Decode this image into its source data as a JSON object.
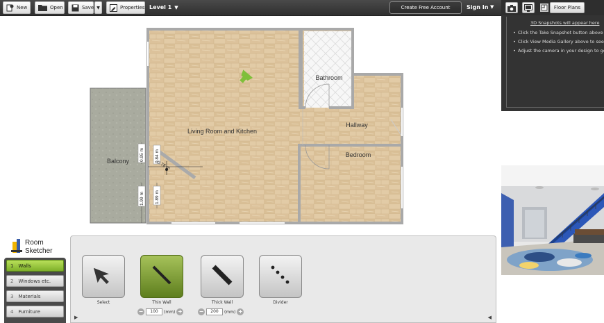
{
  "toolbar": {
    "new": "New",
    "open": "Open",
    "save": "Save",
    "properties": "Properties",
    "level": "Level 1",
    "create_account": "Create Free Account",
    "sign_in": "Sign In"
  },
  "right_panel": {
    "floor_plans": "Floor Plans",
    "snapshots_title": "3D Snapshots will appear here",
    "tips": [
      "Click the Take Snapshot button above to take a snapshot",
      "Click View Media Gallery above to see a larger image",
      "Adjust the camera in your design to get another perspective"
    ]
  },
  "plan": {
    "rooms": {
      "living": "Living Room and Kitchen",
      "bathroom": "Bathroom",
      "hallway": "Hallway",
      "bedroom": "Bedroom",
      "balcony": "Balcony"
    },
    "dims": {
      "d1": "0.95 m",
      "d2": "0.84 m",
      "d3": "0.78 m",
      "d4": "1.99 m",
      "d5": "1.89 m"
    }
  },
  "logo": {
    "line1": "Room",
    "line2": "Sketcher"
  },
  "categories": [
    {
      "n": "1",
      "label": "Walls"
    },
    {
      "n": "2",
      "label": "Windows etc."
    },
    {
      "n": "3",
      "label": "Materials"
    },
    {
      "n": "4",
      "label": "Furniture"
    }
  ],
  "tools": {
    "select": "Select",
    "thin_wall": "Thin Wall",
    "thick_wall": "Thick Wall",
    "divider": "Divider",
    "thin_value": "100",
    "thick_value": "200",
    "unit": "(mm)"
  },
  "colors": {
    "accent_green": "#8bbf2e",
    "floor_wood": "#e0c9a3",
    "balcony": "#a8ab9e",
    "wall": "#a9a9a9"
  }
}
